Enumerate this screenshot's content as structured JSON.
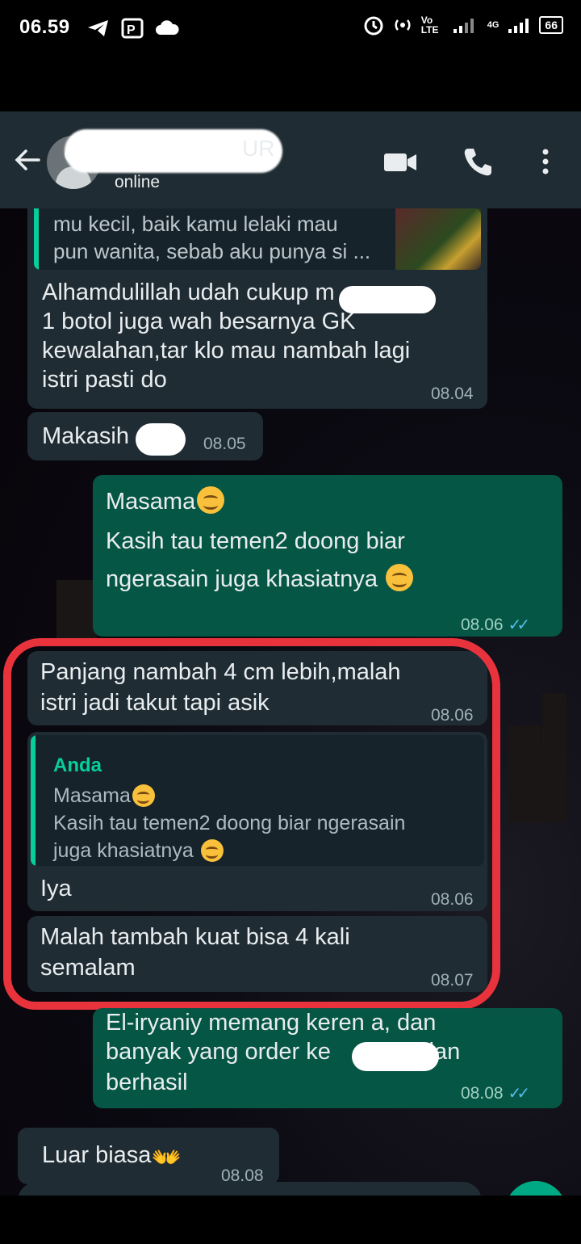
{
  "status_bar": {
    "time": "06.59",
    "network_type": "Vo LTE",
    "network_4g": "4G",
    "battery": "66"
  },
  "header": {
    "name_visible": "UR",
    "status": "online"
  },
  "messages": [
    {
      "quote_text_line1": "mu kecil, baik kamu lelaki mau",
      "quote_text_line2": "pun wanita, sebab aku punya si ...",
      "line1": "Alhamdulillah udah cukup m",
      "line2": "1 botol juga wah besarnya GK",
      "line3": "kewalahan,tar klo mau nambah lagi",
      "line4": "istri pasti do",
      "time": "08.04"
    },
    {
      "text": "Makasih",
      "time": "08.05"
    },
    {
      "line1": "Masama",
      "line2": "Kasih tau temen2 doong biar",
      "line3": "ngerasain juga khasiatnya",
      "time": "08.06"
    },
    {
      "line1": "Panjang nambah 4 cm lebih,malah",
      "line2": "istri jadi takut tapi asik",
      "time": "08.06"
    },
    {
      "quote_author": "Anda",
      "quote_line1": "Masama",
      "quote_line2": "Kasih tau temen2 doong biar ngerasain",
      "quote_line3": "juga khasiatnya",
      "text": "Iya",
      "time": "08.06"
    },
    {
      "line1": "Malah tambah kuat bisa 4 kali",
      "line2": "semalam",
      "time": "08.07"
    },
    {
      "line1": "El-iryaniy memang keren a, dan",
      "line2_a": "banyak yang order ke",
      "line2_b": "dan",
      "line3": "berhasil",
      "time": "08.08"
    },
    {
      "text": "Luar biasa",
      "time": "08.08"
    }
  ],
  "colors": {
    "incoming": "#1f2c34",
    "outgoing": "#065645",
    "appbar": "#1f2c33",
    "ticks": "#53bdeb",
    "highlight": "#e8333d"
  }
}
